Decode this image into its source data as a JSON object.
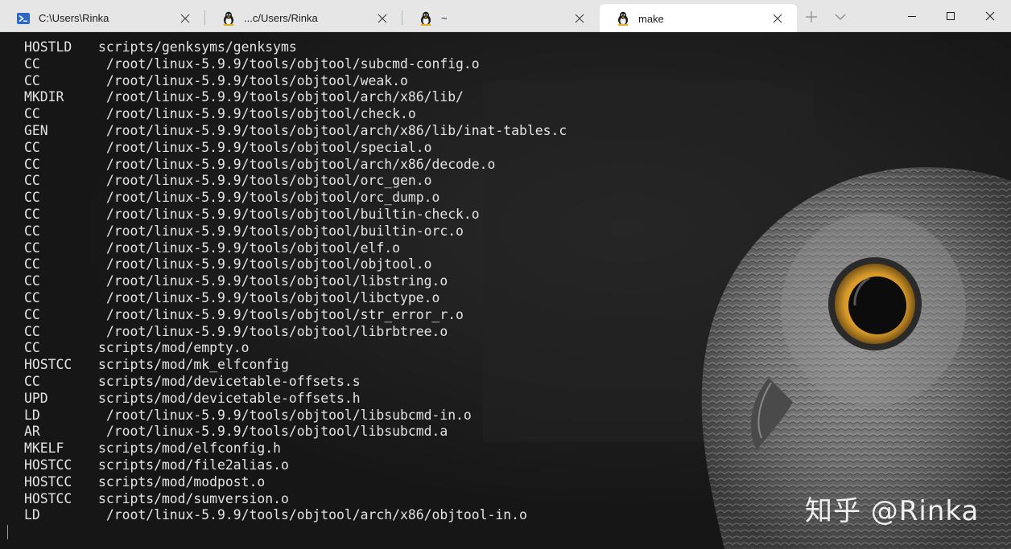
{
  "tabs": [
    {
      "label": "C:\\Users\\Rinka",
      "icon": "powershell-icon"
    },
    {
      "label": "...c/Users/Rinka",
      "icon": "tux-linux-icon"
    },
    {
      "label": "~",
      "icon": "tux-linux-icon"
    },
    {
      "label": "make",
      "icon": "tux-linux-icon",
      "active": true
    }
  ],
  "terminal": {
    "lines": [
      {
        "cmd": "HOSTLD",
        "arg": "scripts/genksyms/genksyms"
      },
      {
        "cmd": "CC",
        "arg": " /root/linux-5.9.9/tools/objtool/subcmd-config.o"
      },
      {
        "cmd": "CC",
        "arg": " /root/linux-5.9.9/tools/objtool/weak.o"
      },
      {
        "cmd": "MKDIR",
        "arg": " /root/linux-5.9.9/tools/objtool/arch/x86/lib/"
      },
      {
        "cmd": "CC",
        "arg": " /root/linux-5.9.9/tools/objtool/check.o"
      },
      {
        "cmd": "GEN",
        "arg": " /root/linux-5.9.9/tools/objtool/arch/x86/lib/inat-tables.c"
      },
      {
        "cmd": "CC",
        "arg": " /root/linux-5.9.9/tools/objtool/special.o"
      },
      {
        "cmd": "CC",
        "arg": " /root/linux-5.9.9/tools/objtool/arch/x86/decode.o"
      },
      {
        "cmd": "CC",
        "arg": " /root/linux-5.9.9/tools/objtool/orc_gen.o"
      },
      {
        "cmd": "CC",
        "arg": " /root/linux-5.9.9/tools/objtool/orc_dump.o"
      },
      {
        "cmd": "CC",
        "arg": " /root/linux-5.9.9/tools/objtool/builtin-check.o"
      },
      {
        "cmd": "CC",
        "arg": " /root/linux-5.9.9/tools/objtool/builtin-orc.o"
      },
      {
        "cmd": "CC",
        "arg": " /root/linux-5.9.9/tools/objtool/elf.o"
      },
      {
        "cmd": "CC",
        "arg": " /root/linux-5.9.9/tools/objtool/objtool.o"
      },
      {
        "cmd": "CC",
        "arg": " /root/linux-5.9.9/tools/objtool/libstring.o"
      },
      {
        "cmd": "CC",
        "arg": " /root/linux-5.9.9/tools/objtool/libctype.o"
      },
      {
        "cmd": "CC",
        "arg": " /root/linux-5.9.9/tools/objtool/str_error_r.o"
      },
      {
        "cmd": "CC",
        "arg": " /root/linux-5.9.9/tools/objtool/librbtree.o"
      },
      {
        "cmd": "CC",
        "arg": "scripts/mod/empty.o"
      },
      {
        "cmd": "HOSTCC",
        "arg": "scripts/mod/mk_elfconfig"
      },
      {
        "cmd": "CC",
        "arg": "scripts/mod/devicetable-offsets.s"
      },
      {
        "cmd": "UPD",
        "arg": "scripts/mod/devicetable-offsets.h"
      },
      {
        "cmd": "LD",
        "arg": " /root/linux-5.9.9/tools/objtool/libsubcmd-in.o"
      },
      {
        "cmd": "AR",
        "arg": " /root/linux-5.9.9/tools/objtool/libsubcmd.a"
      },
      {
        "cmd": "MKELF",
        "arg": "scripts/mod/elfconfig.h"
      },
      {
        "cmd": "HOSTCC",
        "arg": "scripts/mod/file2alias.o"
      },
      {
        "cmd": "HOSTCC",
        "arg": "scripts/mod/modpost.o"
      },
      {
        "cmd": "HOSTCC",
        "arg": "scripts/mod/sumversion.o"
      },
      {
        "cmd": "LD",
        "arg": " /root/linux-5.9.9/tools/objtool/arch/x86/objtool-in.o"
      }
    ]
  },
  "watermark": "知乎 @Rinka",
  "colors": {
    "terminal_bg": "#181818",
    "terminal_fg": "#e4e4e4",
    "tabbar_bg": "#e6e6e6",
    "active_tab_bg": "#ffffff",
    "owl_eye": "#e8b340"
  }
}
